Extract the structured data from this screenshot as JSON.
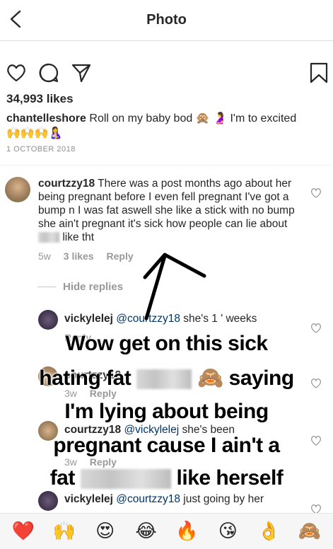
{
  "header": {
    "title": "Photo"
  },
  "post": {
    "likes": "34,993 likes",
    "username": "chantelleshore",
    "caption_a": "Roll on my baby bod",
    "emoji_a": "🙊",
    "emoji_b": "🤰",
    "caption_b": "I'm to excited",
    "caption_emojis": "🙌🙌🙌🤱",
    "date": "1 OCTOBER 2018"
  },
  "comments": [
    {
      "username": "courtzzy18",
      "text_a": "There was a post months ago about her being pregnant before I even fell pregnant I've got a bump n I was fat aswell she like a stick with no bump she ain't pregnant it's sick how people can lie about",
      "text_b": "like tht",
      "time": "5w",
      "likes": "3 likes",
      "reply": "Reply"
    }
  ],
  "hide_replies": "Hide replies",
  "replies": [
    {
      "username": "vickylelej",
      "mention": "@courtzzy18",
      "text": "she's 1 ' weeks",
      "time": "",
      "reply": "Reply"
    },
    {
      "username": "courtzzy18",
      "mention": "",
      "text": "",
      "time": "3w",
      "reply": "Reply"
    },
    {
      "username": "courtzzy18",
      "mention": "@vickylelej",
      "text": "she's been",
      "time": "3w",
      "reply": "Reply"
    },
    {
      "username": "vickylelej",
      "mention": "@courtzzy18",
      "text": "just going by her",
      "time": "",
      "reply": ""
    }
  ],
  "overlay": {
    "line1": "Wow get on this sick",
    "line2a": "hating fat",
    "line2_emoji": "🙈",
    "line2b": "saying",
    "line3": "I'm lying about being",
    "line4": "pregnant cause I ain't a",
    "line5a": "fat",
    "line5b": "like herself"
  },
  "emoji_bar": [
    "❤️",
    "🙌",
    "😍",
    "😂",
    "🔥",
    "😘",
    "👌",
    "🙈"
  ],
  "colors": {
    "heart": "#ed4956",
    "meta": "#999999",
    "mention": "#003569"
  }
}
